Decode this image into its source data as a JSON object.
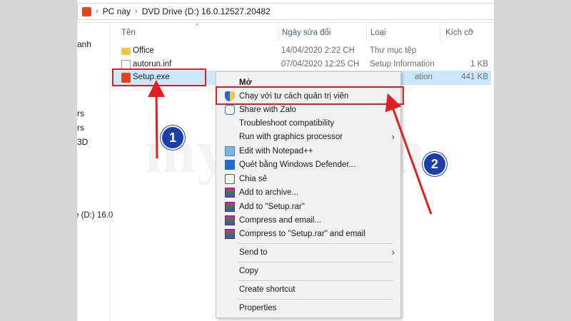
{
  "address": {
    "segments": [
      "PC này",
      "DVD Drive (D:) 16.0.12527.20482"
    ]
  },
  "navpane": {
    "items": [
      "anh",
      "rs",
      "rs",
      "3D",
      "e (D:) 16.0"
    ]
  },
  "columns": {
    "name": "Tên",
    "date": "Ngày sửa đổi",
    "type": "Loại",
    "size": "Kích cỡ"
  },
  "files": [
    {
      "name": "Office",
      "date": "14/04/2020 2:22 CH",
      "type": "Thư mục tệp",
      "size": "",
      "icon": "folder-icon"
    },
    {
      "name": "autorun.inf",
      "date": "07/04/2020 12:25 CH",
      "type": "Setup Information",
      "size": "1 KB",
      "icon": "file-icon"
    },
    {
      "name": "Setup.exe",
      "date": "",
      "type": "ation",
      "size": "441 KB",
      "icon": "office-setup-icon"
    }
  ],
  "context_menu": {
    "items": [
      {
        "label": "Mở",
        "icon": "",
        "submenu": false,
        "bold": true
      },
      {
        "label": "Chạy với tư cách quản trị viên",
        "icon": "uac-shield-icon",
        "submenu": false
      },
      {
        "label": "Share with Zalo",
        "icon": "zalo-icon",
        "submenu": false
      },
      {
        "label": "Troubleshoot compatibility",
        "icon": "",
        "submenu": false
      },
      {
        "label": "Run with graphics processor",
        "icon": "",
        "submenu": true
      },
      {
        "label": "Edit with Notepad++",
        "icon": "notepad-icon",
        "submenu": false
      },
      {
        "label": "Quét bằng Windows Defender...",
        "icon": "defender-icon",
        "submenu": false
      },
      {
        "label": "Chia sẻ",
        "icon": "share-icon",
        "submenu": false
      },
      {
        "label": "Add to archive...",
        "icon": "winrar-icon",
        "submenu": false
      },
      {
        "label": "Add to \"Setup.rar\"",
        "icon": "winrar-icon",
        "submenu": false
      },
      {
        "label": "Compress and email...",
        "icon": "winrar-icon",
        "submenu": false
      },
      {
        "label": "Compress to \"Setup.rar\" and email",
        "icon": "winrar-icon",
        "submenu": false
      },
      {
        "label": "Send to",
        "icon": "",
        "submenu": true
      },
      {
        "label": "Copy",
        "icon": "",
        "submenu": false
      },
      {
        "label": "Create shortcut",
        "icon": "",
        "submenu": false
      },
      {
        "label": "Properties",
        "icon": "",
        "submenu": false
      }
    ],
    "submenu_glyph": "›"
  },
  "annotations": {
    "step1": "1",
    "step2": "2",
    "color": "#e02020",
    "badge_color": "#1d3fa8"
  },
  "watermark": "mytour.vn",
  "colors": {
    "selection": "#cce8ff",
    "menu_bg": "#f2f2f2",
    "office_brand": "#e3461c"
  }
}
